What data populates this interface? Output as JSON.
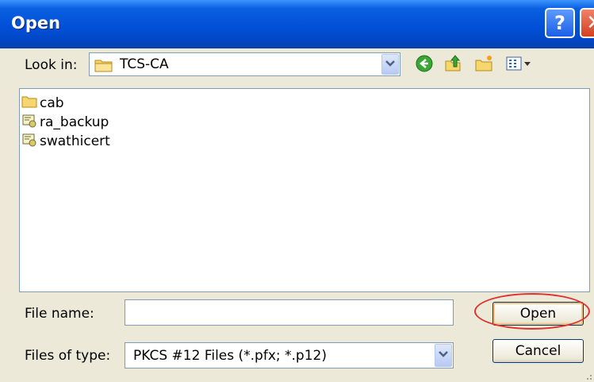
{
  "window": {
    "title": "Open"
  },
  "titlebar": {
    "help_glyph": "?",
    "close_glyph": "✕"
  },
  "look_in": {
    "label": "Look in:",
    "value": "TCS-CA",
    "icon": "folder-icon"
  },
  "toolbar": {
    "icons": [
      "back-icon",
      "up-folder-icon",
      "new-folder-icon",
      "view-menu-icon"
    ]
  },
  "files": [
    {
      "name": "cab",
      "icon": "folder-icon"
    },
    {
      "name": "ra_backup",
      "icon": "certificate-file-icon"
    },
    {
      "name": "swathicert",
      "icon": "certificate-file-icon"
    }
  ],
  "file_name": {
    "label": "File name:",
    "value": ""
  },
  "file_type": {
    "label": "Files of type:",
    "value": "PKCS #12 Files (*.pfx; *.p12)"
  },
  "buttons": {
    "open": "Open",
    "cancel": "Cancel"
  },
  "colors": {
    "title_blue": "#0250d8",
    "face": "#ece9d8",
    "highlight_ring": "#e03030"
  }
}
